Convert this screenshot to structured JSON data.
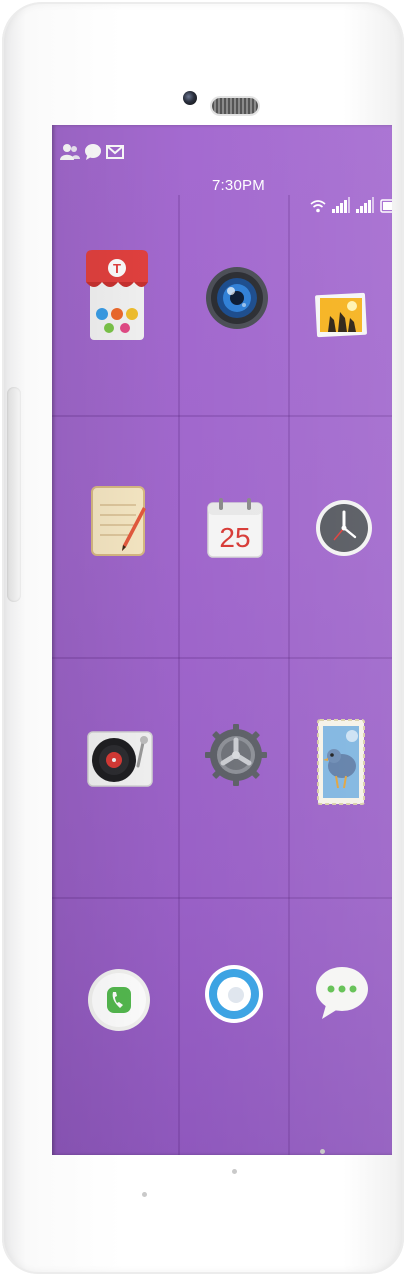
{
  "status_bar": {
    "time": "7:30PM",
    "left_icons": [
      "contacts-icon",
      "chat-icon",
      "mail-icon"
    ],
    "right_icons": [
      "wifi-icon",
      "signal-icon",
      "signal-icon",
      "battery-icon"
    ]
  },
  "calendar": {
    "day": "25"
  },
  "home_apps": [
    {
      "icon": "store-app-icon"
    },
    {
      "icon": "camera-app-icon"
    },
    {
      "icon": "gallery-app-icon"
    },
    {
      "icon": "notes-app-icon"
    },
    {
      "icon": "calendar-app-icon"
    },
    {
      "icon": "clock-app-icon"
    },
    {
      "icon": "music-app-icon"
    },
    {
      "icon": "settings-app-icon"
    },
    {
      "icon": "mail-app-icon"
    }
  ],
  "dock_apps": [
    {
      "icon": "phone-app-icon"
    },
    {
      "icon": "browser-app-icon"
    },
    {
      "icon": "messages-app-icon"
    }
  ],
  "colors": {
    "wallpaper": "#a067cc",
    "device_body": "#ffffff"
  }
}
